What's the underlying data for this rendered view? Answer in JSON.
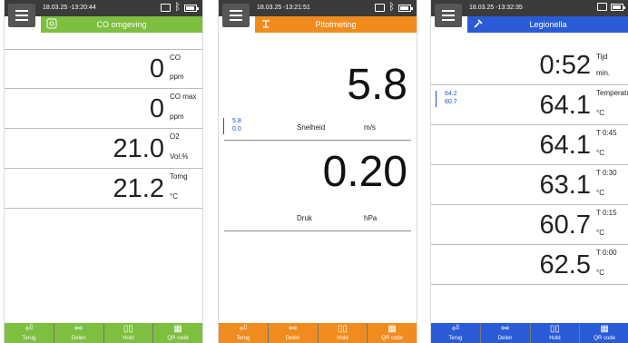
{
  "device1": {
    "datetime": "18.03.25 -13:20:44",
    "title": "CO omgeving",
    "title_color": "#7dbf3f",
    "rows": [
      {
        "value": "0",
        "label": "CO",
        "unit": "ppm"
      },
      {
        "value": "0",
        "label": "CO max",
        "unit": "ppm"
      },
      {
        "value": "21.0",
        "label": "O2",
        "unit": "Vol.%"
      },
      {
        "value": "21.2",
        "label": "Tomg",
        "unit": "°C"
      }
    ],
    "bottom": [
      {
        "icon": "back-icon",
        "label": "Terug"
      },
      {
        "icon": "share-icon",
        "label": "Delen"
      },
      {
        "icon": "hold-icon",
        "label": "Hold"
      },
      {
        "icon": "qr-icon",
        "label": "QR code"
      }
    ]
  },
  "device2": {
    "datetime": "18.03.25 -13:21:51",
    "title": "Pitotmeting",
    "title_color": "#f08c1e",
    "speed_value": "5.8",
    "speed_label": "Snelheid",
    "speed_unit": "m/s",
    "speed_max": "5.8",
    "speed_min": "0.0",
    "pressure_value": "0.20",
    "pressure_label": "Druk",
    "pressure_unit": "hPa",
    "bottom": [
      {
        "icon": "back-icon",
        "label": "Terug"
      },
      {
        "icon": "share-icon",
        "label": "Delen"
      },
      {
        "icon": "hold-icon",
        "label": "Hold"
      },
      {
        "icon": "qr-icon",
        "label": "QR code"
      }
    ]
  },
  "device3": {
    "datetime": "18.03.25 -13:32:35",
    "title": "Legionella",
    "title_color": "#2a5bd7",
    "time_value": "0:52",
    "time_label": "Tijd",
    "time_unit": "min.",
    "max": "64.2",
    "min": "60.7",
    "rows": [
      {
        "value": "64.1",
        "label": "Temperatu..",
        "unit": "°C"
      },
      {
        "value": "64.1",
        "label": "T 0:45",
        "unit": "°C"
      },
      {
        "value": "63.1",
        "label": "T 0:30",
        "unit": "°C"
      },
      {
        "value": "60.7",
        "label": "T 0:15",
        "unit": "°C"
      },
      {
        "value": "62.5",
        "label": "T 0:00",
        "unit": "°C"
      }
    ],
    "bottom": [
      {
        "icon": "back-icon",
        "label": "Terug"
      },
      {
        "icon": "share-icon",
        "label": "Delen"
      },
      {
        "icon": "hold-icon",
        "label": "Hold"
      },
      {
        "icon": "qr-icon",
        "label": "QR code"
      }
    ]
  }
}
